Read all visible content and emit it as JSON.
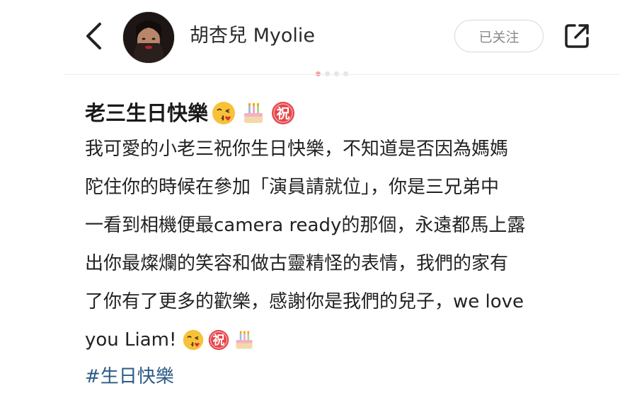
{
  "header": {
    "username": "胡杏兒 Myolie",
    "follow_label": "已关注"
  },
  "post": {
    "title": "老三生日快樂",
    "title_emojis": [
      "kiss-emoji",
      "cake-emoji",
      "congrats-emoji"
    ],
    "body_lines": [
      "我可愛的小老三祝你生日快樂，不知道是否因為媽媽",
      "陀住你的時候在參加「演員請就位」，你是三兄弟中",
      "一看到相機便最camera ready的那個，永遠都馬上露",
      "出你最燦爛的笑容和做古靈精怪的表情，我們的家有",
      "了你有了更多的歡樂，感謝你是我們的兒子，we love",
      "you Liam!"
    ],
    "end_emojis": [
      "kiss-emoji",
      "congrats-emoji",
      "cake-emoji"
    ],
    "hashtag": "#生日快樂"
  }
}
